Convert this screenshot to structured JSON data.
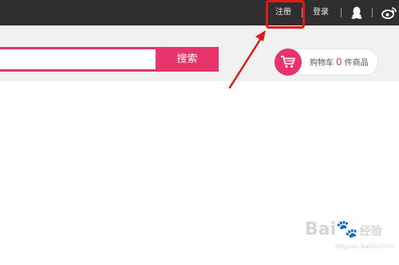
{
  "header": {
    "register_label": "注册",
    "login_label": "登录",
    "icons": [
      "qq-icon",
      "weibo-icon"
    ]
  },
  "search": {
    "value": "",
    "placeholder": "",
    "button_label": "搜索"
  },
  "cart": {
    "label_before": "购物车",
    "count": "0",
    "label_after": "件商品"
  },
  "annotation": {
    "highlight_color": "#e01818"
  },
  "watermark": {
    "brand": "Bai",
    "brand_suffix": "经验",
    "url": "jingyan.baidu.com"
  },
  "colors": {
    "topbar": "#2f2f2f",
    "accent": "#e8336b"
  }
}
